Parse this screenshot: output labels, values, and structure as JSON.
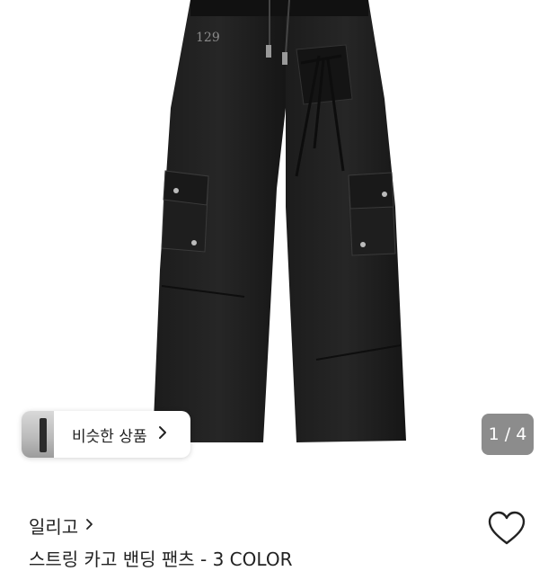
{
  "gallery": {
    "similar_label": "비슷한 상품",
    "page_indicator": "1 / 4",
    "logo_text": "129"
  },
  "product": {
    "brand": "일리고",
    "title": "스트링 카고 밴딩 팬츠 - 3 COLOR"
  },
  "icons": {
    "similar_chevron": "chevron-right-icon",
    "brand_chevron": "chevron-right-icon",
    "wishlist": "heart-outline-icon"
  }
}
